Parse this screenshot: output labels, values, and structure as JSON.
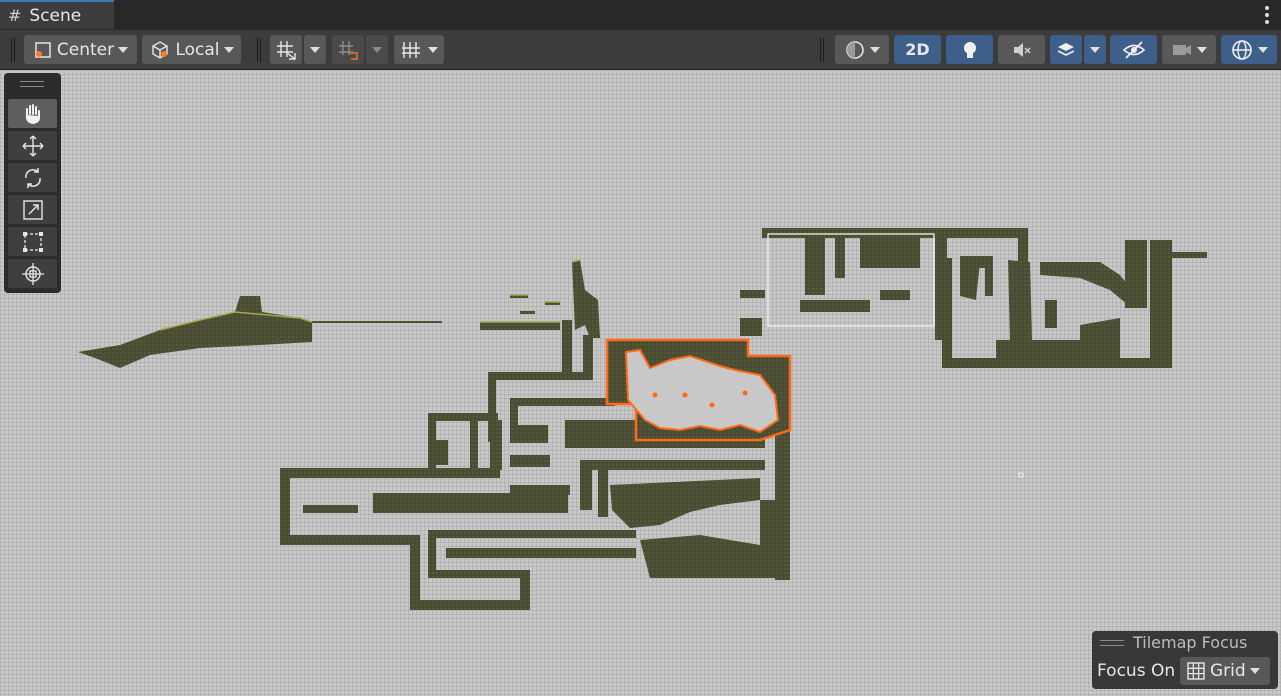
{
  "window": {
    "tab_title": "Scene",
    "tab_icon": "grid-hash-icon",
    "menu_icon": "kebab-menu-icon"
  },
  "toolbar": {
    "pivot_label": "Center",
    "pivot_icon": "pivot-center-icon",
    "handle_rotation_label": "Local",
    "handle_rotation_icon": "local-cube-icon",
    "grid_snapping_icon": "grid-snapping-icon",
    "increment_snap_icon": "increment-snap-icon",
    "grid_visibility_icon": "grid-visibility-icon",
    "draw_mode_icon": "shading-mode-icon",
    "toggle_2d_label": "2D",
    "lighting_icon": "light-bulb-icon",
    "audio_icon": "audio-mute-icon",
    "effects_icon": "effects-layers-icon",
    "visibility_icon": "hidden-eye-icon",
    "camera_icon": "camera-icon",
    "gizmos_icon": "gizmos-globe-icon"
  },
  "tools": [
    {
      "name": "view-tool",
      "icon": "hand-icon",
      "active": true
    },
    {
      "name": "move-tool",
      "icon": "move-arrows-icon",
      "active": false
    },
    {
      "name": "rotate-tool",
      "icon": "rotate-icon",
      "active": false
    },
    {
      "name": "scale-tool",
      "icon": "scale-icon",
      "active": false
    },
    {
      "name": "rect-tool",
      "icon": "rect-transform-icon",
      "active": false
    },
    {
      "name": "transform-tool",
      "icon": "transform-icon",
      "active": false
    }
  ],
  "tilemap_focus": {
    "title": "Tilemap Focus",
    "focus_label": "Focus On",
    "focus_value": "Grid",
    "focus_icon": "grid-icon"
  },
  "colors": {
    "editor_dark": "#3c3c3c",
    "active_blue": "#3e5f8a",
    "tab_accent": "#3a79bb",
    "scene_bg": "#c8c8c8",
    "tilemap_olive": "#4a4d33",
    "tilemap_highlight": "#a6a84a",
    "selection_outline": "#ff6a1a"
  }
}
